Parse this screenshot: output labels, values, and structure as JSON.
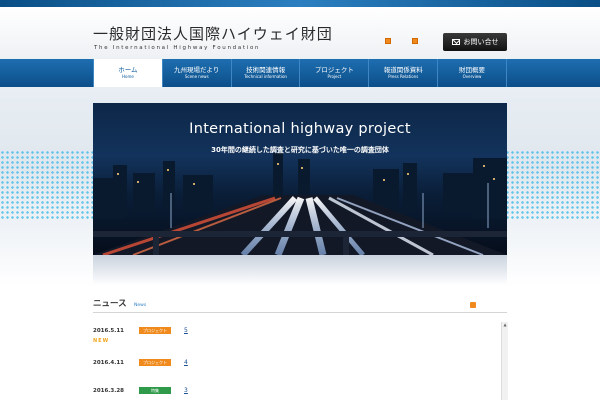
{
  "header": {
    "logo_jp": "一般財団法人国際ハイウェイ財団",
    "logo_en": "The International Highway Foundation",
    "contact_label": "お問い合せ"
  },
  "nav": {
    "items": [
      {
        "jp": "ホーム",
        "en": "Home"
      },
      {
        "jp": "九州現場だより",
        "en": "Scene news"
      },
      {
        "jp": "技術関連情報",
        "en": "Technical information"
      },
      {
        "jp": "プロジェクト",
        "en": "Project"
      },
      {
        "jp": "報道関係資料",
        "en": "Press Relations"
      },
      {
        "jp": "財団概要",
        "en": "Overview"
      }
    ]
  },
  "hero": {
    "title": "International highway project",
    "subtitle": "30年間の継続した調査と研究に基づいた唯一の調査団体"
  },
  "news": {
    "heading": "ニュース",
    "heading_en": "News",
    "items": [
      {
        "date": "2016.5.11",
        "tag": "プロジェクト",
        "tag_color": "#f08a1c",
        "link": "5",
        "new_label": "NEW"
      },
      {
        "date": "2016.4.11",
        "tag": "プロジェクト",
        "tag_color": "#f08a1c",
        "link": "4"
      },
      {
        "date": "2016.3.28",
        "tag": "特集",
        "tag_color": "#2e9a4a",
        "link": "3"
      }
    ]
  },
  "colors": {
    "nav_blue": "#0c4f8a",
    "accent_orange": "#f08a1c",
    "link_blue": "#1a4f95"
  }
}
